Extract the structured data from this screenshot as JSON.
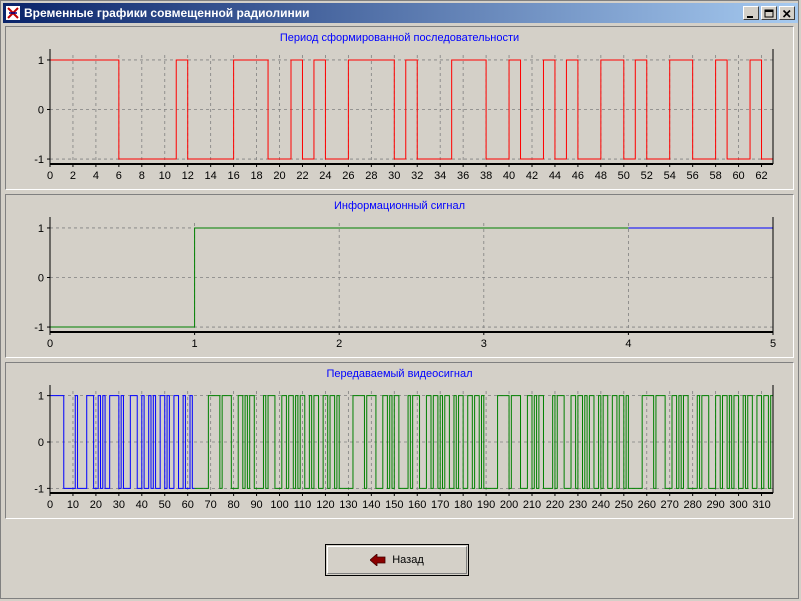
{
  "window": {
    "title": "Временные графики совмещенной радиолинии",
    "controls": [
      "minimize",
      "maximize",
      "close"
    ]
  },
  "back_button": {
    "label": "Назад"
  },
  "chart_data": [
    {
      "type": "line",
      "title": "Период сформированной последовательности",
      "xlim": [
        0,
        63
      ],
      "ylim": [
        -1.1,
        1.1
      ],
      "x_ticks": [
        0,
        2,
        4,
        6,
        8,
        10,
        12,
        14,
        16,
        18,
        20,
        22,
        24,
        26,
        28,
        30,
        32,
        34,
        36,
        38,
        40,
        42,
        44,
        46,
        48,
        50,
        52,
        54,
        56,
        58,
        60,
        62
      ],
      "y_ticks": [
        1,
        0,
        -1
      ],
      "grid": true,
      "series": [
        {
          "color": "#ff0000",
          "step": true,
          "x": [
            0,
            6,
            11,
            12,
            16,
            19,
            21,
            22,
            23,
            24,
            26,
            30,
            31,
            32,
            35,
            38,
            40,
            41,
            43,
            44,
            45,
            46,
            48,
            50,
            51,
            52,
            54,
            56,
            58,
            59,
            61,
            62,
            63
          ],
          "y": [
            1,
            -1,
            1,
            -1,
            1,
            -1,
            1,
            -1,
            1,
            -1,
            1,
            -1,
            1,
            -1,
            1,
            -1,
            1,
            -1,
            1,
            -1,
            1,
            -1,
            1,
            -1,
            1,
            -1,
            1,
            -1,
            1,
            -1,
            1,
            -1,
            -1
          ]
        }
      ]
    },
    {
      "type": "line",
      "title": "Информационный сигнал",
      "xlim": [
        0,
        5
      ],
      "ylim": [
        -1.1,
        1.1
      ],
      "x_ticks": [
        0,
        1,
        2,
        3,
        4,
        5
      ],
      "y_ticks": [
        1,
        0,
        -1
      ],
      "grid": true,
      "series": [
        {
          "color": "#008000",
          "step": true,
          "x": [
            0,
            1,
            4
          ],
          "y": [
            -1,
            1,
            1
          ]
        },
        {
          "color": "#0000ff",
          "step": true,
          "x": [
            4,
            5
          ],
          "y": [
            1,
            1
          ]
        }
      ]
    },
    {
      "type": "line",
      "title": "Передаваемый видеосигнал",
      "xlim": [
        0,
        315
      ],
      "ylim": [
        -1.1,
        1.1
      ],
      "x_ticks": [
        0,
        10,
        20,
        30,
        40,
        50,
        60,
        70,
        80,
        90,
        100,
        110,
        120,
        130,
        140,
        150,
        160,
        170,
        180,
        190,
        200,
        210,
        220,
        230,
        240,
        250,
        260,
        270,
        280,
        290,
        300,
        310
      ],
      "y_ticks": [
        1,
        0,
        -1
      ],
      "grid": true,
      "symbol_length": 63,
      "segments": [
        {
          "color": "#0000ff",
          "invert": false,
          "x_start": 0,
          "x_end": 63
        },
        {
          "color": "#008000",
          "invert": true,
          "x_start": 63,
          "x_end": 315
        }
      ],
      "sequence_transitions": [
        0,
        6,
        11,
        12,
        16,
        19,
        21,
        22,
        23,
        24,
        26,
        30,
        31,
        32,
        35,
        38,
        40,
        41,
        43,
        44,
        45,
        46,
        48,
        50,
        51,
        52,
        54,
        56,
        58,
        59,
        61,
        62,
        63
      ],
      "sequence_levels": [
        1,
        -1,
        1,
        -1,
        1,
        -1,
        1,
        -1,
        1,
        -1,
        1,
        -1,
        1,
        -1,
        1,
        -1,
        1,
        -1,
        1,
        -1,
        1,
        -1,
        1,
        -1,
        1,
        -1,
        1,
        -1,
        1,
        -1,
        1,
        -1,
        -1
      ]
    }
  ]
}
